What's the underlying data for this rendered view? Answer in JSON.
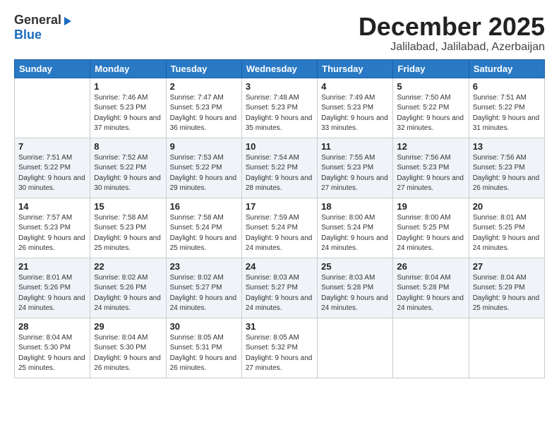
{
  "logo": {
    "general": "General",
    "blue": "Blue"
  },
  "header": {
    "month": "December 2025",
    "location": "Jalilabad, Jalilabad, Azerbaijan"
  },
  "days": [
    "Sunday",
    "Monday",
    "Tuesday",
    "Wednesday",
    "Thursday",
    "Friday",
    "Saturday"
  ],
  "weeks": [
    [
      {
        "day": "",
        "sunrise": "",
        "sunset": "",
        "daylight": ""
      },
      {
        "day": "1",
        "sunrise": "Sunrise: 7:46 AM",
        "sunset": "Sunset: 5:23 PM",
        "daylight": "Daylight: 9 hours and 37 minutes."
      },
      {
        "day": "2",
        "sunrise": "Sunrise: 7:47 AM",
        "sunset": "Sunset: 5:23 PM",
        "daylight": "Daylight: 9 hours and 36 minutes."
      },
      {
        "day": "3",
        "sunrise": "Sunrise: 7:48 AM",
        "sunset": "Sunset: 5:23 PM",
        "daylight": "Daylight: 9 hours and 35 minutes."
      },
      {
        "day": "4",
        "sunrise": "Sunrise: 7:49 AM",
        "sunset": "Sunset: 5:23 PM",
        "daylight": "Daylight: 9 hours and 33 minutes."
      },
      {
        "day": "5",
        "sunrise": "Sunrise: 7:50 AM",
        "sunset": "Sunset: 5:22 PM",
        "daylight": "Daylight: 9 hours and 32 minutes."
      },
      {
        "day": "6",
        "sunrise": "Sunrise: 7:51 AM",
        "sunset": "Sunset: 5:22 PM",
        "daylight": "Daylight: 9 hours and 31 minutes."
      }
    ],
    [
      {
        "day": "7",
        "sunrise": "Sunrise: 7:51 AM",
        "sunset": "Sunset: 5:22 PM",
        "daylight": "Daylight: 9 hours and 30 minutes."
      },
      {
        "day": "8",
        "sunrise": "Sunrise: 7:52 AM",
        "sunset": "Sunset: 5:22 PM",
        "daylight": "Daylight: 9 hours and 30 minutes."
      },
      {
        "day": "9",
        "sunrise": "Sunrise: 7:53 AM",
        "sunset": "Sunset: 5:22 PM",
        "daylight": "Daylight: 9 hours and 29 minutes."
      },
      {
        "day": "10",
        "sunrise": "Sunrise: 7:54 AM",
        "sunset": "Sunset: 5:22 PM",
        "daylight": "Daylight: 9 hours and 28 minutes."
      },
      {
        "day": "11",
        "sunrise": "Sunrise: 7:55 AM",
        "sunset": "Sunset: 5:23 PM",
        "daylight": "Daylight: 9 hours and 27 minutes."
      },
      {
        "day": "12",
        "sunrise": "Sunrise: 7:56 AM",
        "sunset": "Sunset: 5:23 PM",
        "daylight": "Daylight: 9 hours and 27 minutes."
      },
      {
        "day": "13",
        "sunrise": "Sunrise: 7:56 AM",
        "sunset": "Sunset: 5:23 PM",
        "daylight": "Daylight: 9 hours and 26 minutes."
      }
    ],
    [
      {
        "day": "14",
        "sunrise": "Sunrise: 7:57 AM",
        "sunset": "Sunset: 5:23 PM",
        "daylight": "Daylight: 9 hours and 26 minutes."
      },
      {
        "day": "15",
        "sunrise": "Sunrise: 7:58 AM",
        "sunset": "Sunset: 5:23 PM",
        "daylight": "Daylight: 9 hours and 25 minutes."
      },
      {
        "day": "16",
        "sunrise": "Sunrise: 7:58 AM",
        "sunset": "Sunset: 5:24 PM",
        "daylight": "Daylight: 9 hours and 25 minutes."
      },
      {
        "day": "17",
        "sunrise": "Sunrise: 7:59 AM",
        "sunset": "Sunset: 5:24 PM",
        "daylight": "Daylight: 9 hours and 24 minutes."
      },
      {
        "day": "18",
        "sunrise": "Sunrise: 8:00 AM",
        "sunset": "Sunset: 5:24 PM",
        "daylight": "Daylight: 9 hours and 24 minutes."
      },
      {
        "day": "19",
        "sunrise": "Sunrise: 8:00 AM",
        "sunset": "Sunset: 5:25 PM",
        "daylight": "Daylight: 9 hours and 24 minutes."
      },
      {
        "day": "20",
        "sunrise": "Sunrise: 8:01 AM",
        "sunset": "Sunset: 5:25 PM",
        "daylight": "Daylight: 9 hours and 24 minutes."
      }
    ],
    [
      {
        "day": "21",
        "sunrise": "Sunrise: 8:01 AM",
        "sunset": "Sunset: 5:26 PM",
        "daylight": "Daylight: 9 hours and 24 minutes."
      },
      {
        "day": "22",
        "sunrise": "Sunrise: 8:02 AM",
        "sunset": "Sunset: 5:26 PM",
        "daylight": "Daylight: 9 hours and 24 minutes."
      },
      {
        "day": "23",
        "sunrise": "Sunrise: 8:02 AM",
        "sunset": "Sunset: 5:27 PM",
        "daylight": "Daylight: 9 hours and 24 minutes."
      },
      {
        "day": "24",
        "sunrise": "Sunrise: 8:03 AM",
        "sunset": "Sunset: 5:27 PM",
        "daylight": "Daylight: 9 hours and 24 minutes."
      },
      {
        "day": "25",
        "sunrise": "Sunrise: 8:03 AM",
        "sunset": "Sunset: 5:28 PM",
        "daylight": "Daylight: 9 hours and 24 minutes."
      },
      {
        "day": "26",
        "sunrise": "Sunrise: 8:04 AM",
        "sunset": "Sunset: 5:28 PM",
        "daylight": "Daylight: 9 hours and 24 minutes."
      },
      {
        "day": "27",
        "sunrise": "Sunrise: 8:04 AM",
        "sunset": "Sunset: 5:29 PM",
        "daylight": "Daylight: 9 hours and 25 minutes."
      }
    ],
    [
      {
        "day": "28",
        "sunrise": "Sunrise: 8:04 AM",
        "sunset": "Sunset: 5:30 PM",
        "daylight": "Daylight: 9 hours and 25 minutes."
      },
      {
        "day": "29",
        "sunrise": "Sunrise: 8:04 AM",
        "sunset": "Sunset: 5:30 PM",
        "daylight": "Daylight: 9 hours and 26 minutes."
      },
      {
        "day": "30",
        "sunrise": "Sunrise: 8:05 AM",
        "sunset": "Sunset: 5:31 PM",
        "daylight": "Daylight: 9 hours and 26 minutes."
      },
      {
        "day": "31",
        "sunrise": "Sunrise: 8:05 AM",
        "sunset": "Sunset: 5:32 PM",
        "daylight": "Daylight: 9 hours and 27 minutes."
      },
      {
        "day": "",
        "sunrise": "",
        "sunset": "",
        "daylight": ""
      },
      {
        "day": "",
        "sunrise": "",
        "sunset": "",
        "daylight": ""
      },
      {
        "day": "",
        "sunrise": "",
        "sunset": "",
        "daylight": ""
      }
    ]
  ]
}
